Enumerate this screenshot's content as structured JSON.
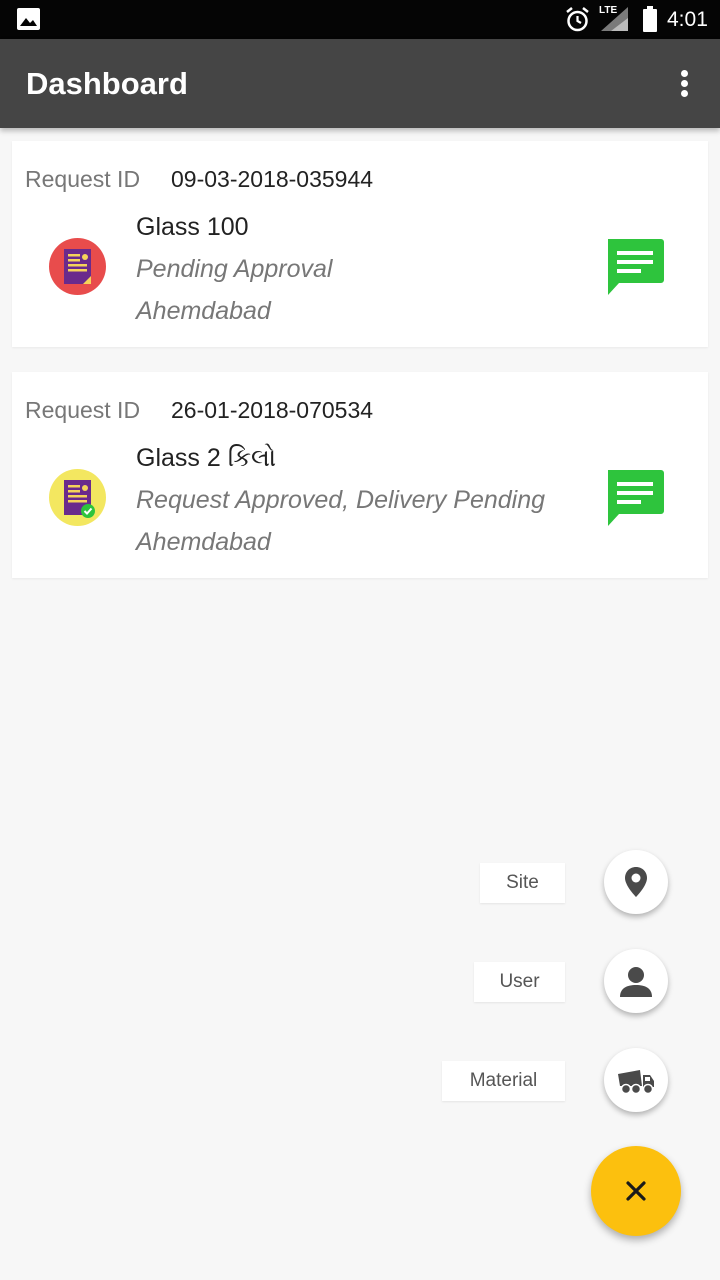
{
  "status_bar": {
    "time": "4:01",
    "network": "LTE",
    "icons": [
      "gallery-icon",
      "alarm-icon",
      "lte-signal-icon",
      "battery-icon"
    ]
  },
  "app_bar": {
    "title": "Dashboard",
    "overflow_icon": "more-vert-icon"
  },
  "requests": [
    {
      "request_id_label": "Request ID",
      "request_id": "09-03-2018-035944",
      "item": "Glass 100",
      "status": "Pending Approval",
      "location": "Ahemdabad",
      "avatar_color": "#e84c4c",
      "status_icon": "pending-document-icon"
    },
    {
      "request_id_label": "Request ID",
      "request_id": "26-01-2018-070534",
      "item": "Glass 2 કિલો",
      "status": "Request Approved, Delivery Pending",
      "location": "Ahemdabad",
      "avatar_color": "#f3e760",
      "status_icon": "approved-document-icon"
    }
  ],
  "fab_menu": {
    "items": [
      {
        "label": "Site",
        "icon": "location-pin-icon"
      },
      {
        "label": "User",
        "icon": "person-icon"
      },
      {
        "label": "Material",
        "icon": "dump-truck-icon"
      }
    ],
    "main_icon": "close-icon",
    "main_color": "#fcc00e"
  },
  "colors": {
    "app_bar": "#454545",
    "message_icon": "#2ec43d"
  }
}
